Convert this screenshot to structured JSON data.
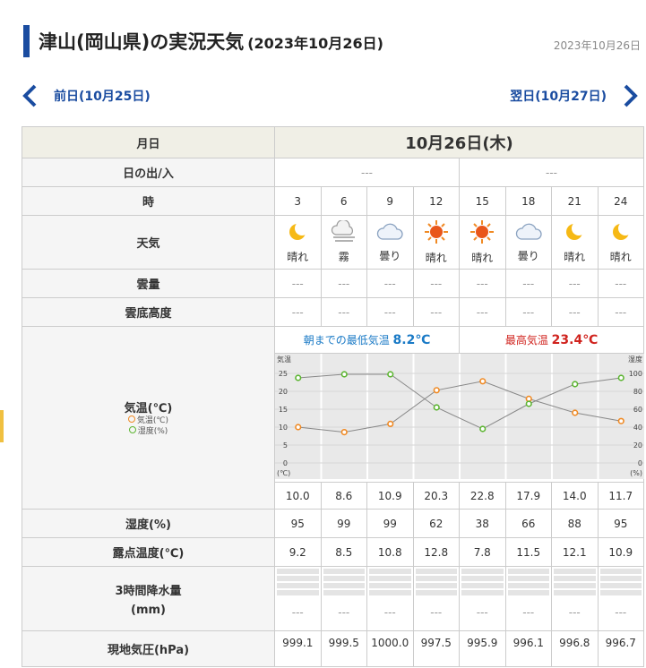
{
  "page": {
    "title": "津山(岡山県)の実況天気",
    "title_date": "(2023年10月26日)",
    "date_label": "2023年10月26日"
  },
  "nav": {
    "prev": "前日(10月25日)",
    "next": "翌日(10月27日)"
  },
  "table": {
    "labels": {
      "date": "月日",
      "sun": "日の出/入",
      "hour": "時",
      "weather": "天気",
      "cloud": "雲量",
      "ceiling": "雲底高度",
      "temp": "気温(℃)",
      "humidity": "湿度(%)",
      "dew": "露点温度(℃)",
      "rain_a": "3時間降水量",
      "rain_b": "(mm)",
      "pressure": "現地気圧(hPa)"
    },
    "date": "10月26日(木)",
    "sunrise": "---",
    "sunset": "---",
    "hours": [
      "3",
      "6",
      "9",
      "12",
      "15",
      "18",
      "21",
      "24"
    ],
    "weather": [
      {
        "icon": "moon-icon",
        "text": "晴れ"
      },
      {
        "icon": "fog-icon",
        "text": "霧"
      },
      {
        "icon": "cloud-icon",
        "text": "曇り"
      },
      {
        "icon": "sun-icon",
        "text": "晴れ"
      },
      {
        "icon": "sun-icon",
        "text": "晴れ"
      },
      {
        "icon": "cloud-icon",
        "text": "曇り"
      },
      {
        "icon": "moon-icon",
        "text": "晴れ"
      },
      {
        "icon": "moon-icon",
        "text": "晴れ"
      }
    ],
    "cloud": [
      "---",
      "---",
      "---",
      "---",
      "---",
      "---",
      "---",
      "---"
    ],
    "ceiling": [
      "---",
      "---",
      "---",
      "---",
      "---",
      "---",
      "---",
      "---"
    ],
    "tmin_label": "朝までの最低気温",
    "tmin_value": "8.2℃",
    "tmax_label": "最高気温",
    "tmax_value": "23.4℃",
    "legend_temp": "気温(℃)",
    "legend_hum": "湿度(%)",
    "temps": [
      "10.0",
      "8.6",
      "10.9",
      "20.3",
      "22.8",
      "17.9",
      "14.0",
      "11.7"
    ],
    "humidity": [
      "95",
      "99",
      "99",
      "62",
      "38",
      "66",
      "88",
      "95"
    ],
    "dew": [
      "9.2",
      "8.5",
      "10.8",
      "12.8",
      "7.8",
      "11.5",
      "12.1",
      "10.9"
    ],
    "rain": [
      "---",
      "---",
      "---",
      "---",
      "---",
      "---",
      "---",
      "---"
    ],
    "pressure": [
      "999.1",
      "999.5",
      "1000.0",
      "997.5",
      "995.9",
      "996.1",
      "996.8",
      "996.7"
    ]
  },
  "chart_data": {
    "type": "line",
    "x": [
      3,
      6,
      9,
      12,
      15,
      18,
      21,
      24
    ],
    "series": [
      {
        "name": "気温(℃)",
        "values": [
          10.0,
          8.6,
          10.9,
          20.3,
          22.8,
          17.9,
          14.0,
          11.7
        ],
        "color": "#f08a24",
        "axis": "left"
      },
      {
        "name": "湿度(%)",
        "values": [
          95,
          99,
          99,
          62,
          38,
          66,
          88,
          95
        ],
        "color": "#5cb531",
        "axis": "right"
      }
    ],
    "left_axis": {
      "label": "気温",
      "unit": "(℃)",
      "ticks": [
        "25",
        "20",
        "15",
        "10",
        "5",
        "0"
      ],
      "range": [
        0,
        25
      ]
    },
    "right_axis": {
      "label": "湿度",
      "unit": "(%)",
      "ticks": [
        "100",
        "80",
        "60",
        "40",
        "20",
        "0"
      ],
      "range": [
        0,
        100
      ]
    },
    "grid": true
  },
  "colors": {
    "accent": "#1a4ca0",
    "temp": "#f08a24",
    "humidity": "#5cb531",
    "min": "#1a7ac6",
    "max": "#d0231e"
  }
}
